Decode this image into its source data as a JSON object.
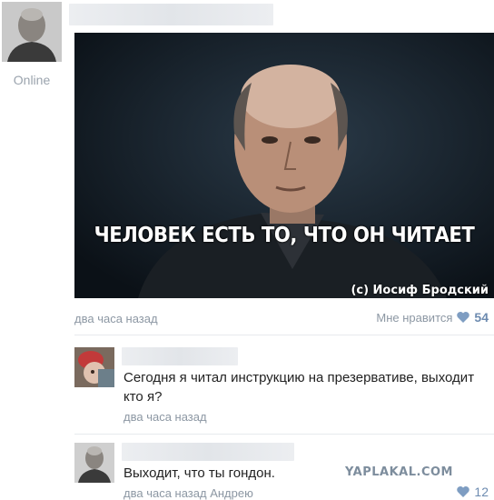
{
  "post": {
    "author_status": "Online",
    "image_quote": "ЧЕЛОВЕК ЕСТЬ ТО, ЧТО ОН ЧИТАЕТ",
    "image_credit": "(с) Иосиф Бродский",
    "time": "два часа назад",
    "like_label": "Мне нравится",
    "like_count": "54"
  },
  "comments": [
    {
      "text": "Сегодня я читал инструкцию на презервативе, выходит кто я?",
      "time": "два часа назад"
    },
    {
      "text": "Выходит, что ты гондон.",
      "time": "два часа назад",
      "reply_to": "Андрею",
      "like_count": "12"
    }
  ],
  "watermark": "YAPLAKAL.COM",
  "colors": {
    "link_gray": "#8c97a3",
    "like_blue": "#6d8bb0",
    "image_bg": "#121a22"
  }
}
